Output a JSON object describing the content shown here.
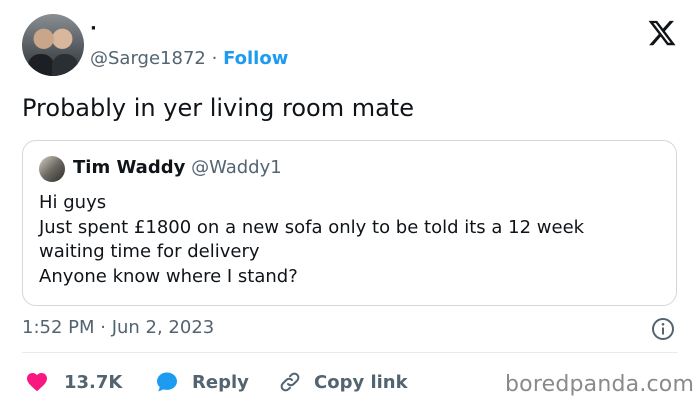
{
  "author": {
    "display_name": "·",
    "handle": "@Sarge1872",
    "separator": "·",
    "follow_label": "Follow"
  },
  "tweet": {
    "text": "Probably in yer living room mate",
    "timestamp": "1:52 PM · Jun 2, 2023"
  },
  "quoted_tweet": {
    "name": "Tim Waddy",
    "handle": "@Waddy1",
    "lines": [
      "Hi guys",
      "Just spent £1800 on a new sofa only to be told its a 12 week",
      "waiting time for delivery",
      "Anyone know where I stand?"
    ]
  },
  "actions": {
    "like_count": "13.7K",
    "reply_label": "Reply",
    "copy_link_label": "Copy link"
  },
  "watermark": "boredpanda.com",
  "colors": {
    "link_blue": "#1d9bf0",
    "like_pink": "#f91880",
    "secondary_text": "#536471",
    "border": "#cfd9de"
  },
  "icons": [
    "x-logo-icon",
    "info-icon",
    "heart-icon",
    "reply-bubble-icon",
    "link-icon"
  ]
}
